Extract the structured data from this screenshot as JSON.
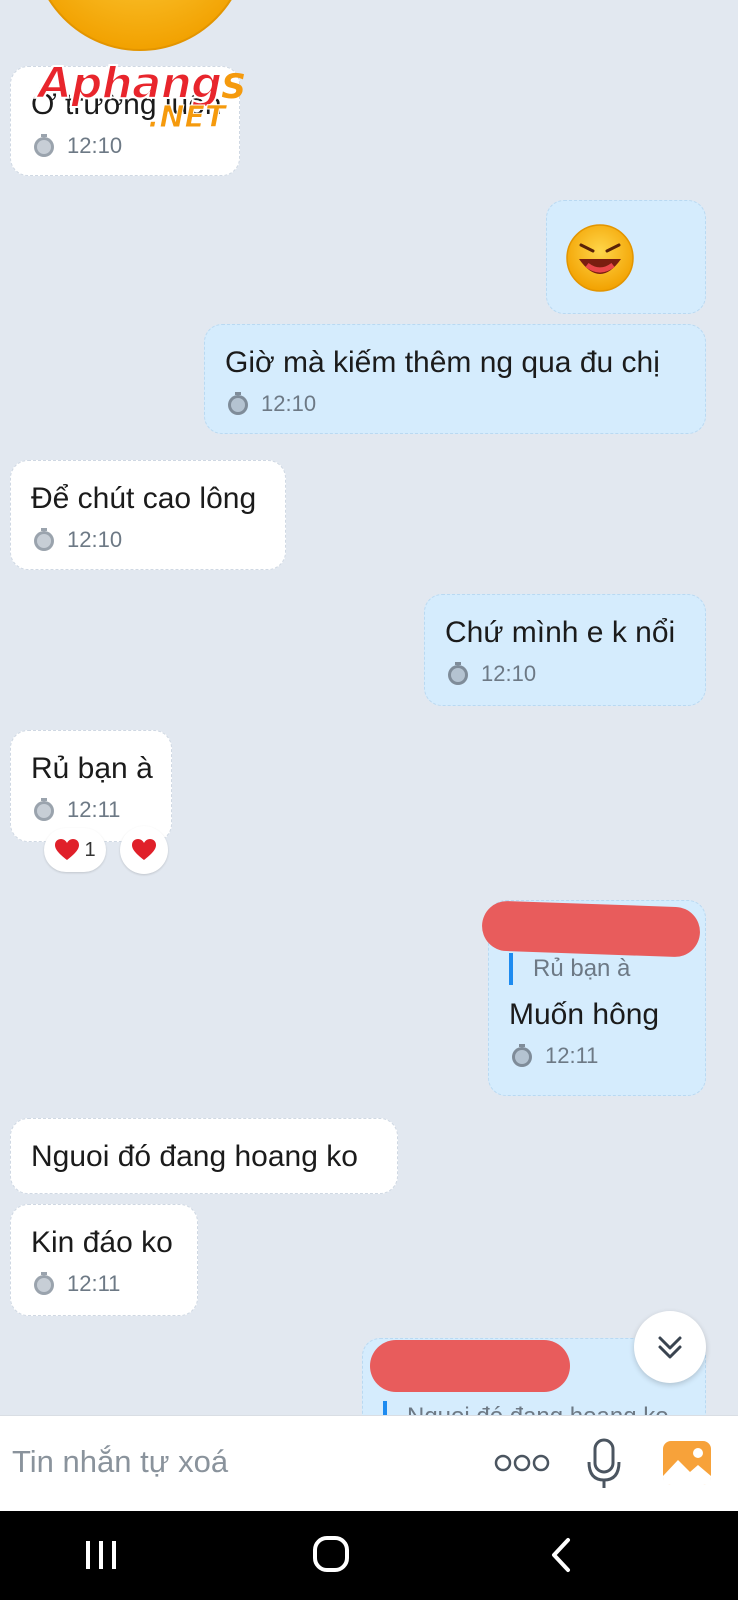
{
  "messages": [
    {
      "id": "m1",
      "side": "in",
      "text": "Ở trường luôn",
      "time": "12:10"
    },
    {
      "id": "m2",
      "side": "out",
      "emoji": "laughing-face"
    },
    {
      "id": "m3",
      "side": "out",
      "text": "Giờ mà kiếm thêm ng qua đu chị",
      "time": "12:10"
    },
    {
      "id": "m4",
      "side": "in",
      "text": "Để chút cao lông",
      "time": "12:10"
    },
    {
      "id": "m5",
      "side": "out",
      "text": "Chứ mình e k nổi",
      "time": "12:10"
    },
    {
      "id": "m6",
      "side": "in",
      "text": "Rủ bạn à",
      "time": "12:11",
      "reaction_count": "1"
    },
    {
      "id": "m7",
      "side": "out",
      "quote": "Rủ bạn à",
      "text": "Muốn hông",
      "time": "12:11"
    },
    {
      "id": "m8",
      "side": "in",
      "text": "Nguoi đó đang hoang ko"
    },
    {
      "id": "m9",
      "side": "in",
      "text": "Kin đáo ko",
      "time": "12:11"
    },
    {
      "id": "m10",
      "side": "out",
      "quote": "Nguoi đó đang hoang ko"
    }
  ],
  "watermark": {
    "main": "Aphang",
    "s": "S",
    "net": ".NET"
  },
  "input": {
    "placeholder": "Tin nhắn tự xoá"
  },
  "colors": {
    "accent": "#1d8bf0",
    "incoming": "#ffffff",
    "outgoing": "#d5ecfd",
    "redaction": "#e85c5c",
    "heart": "#e0202a"
  }
}
